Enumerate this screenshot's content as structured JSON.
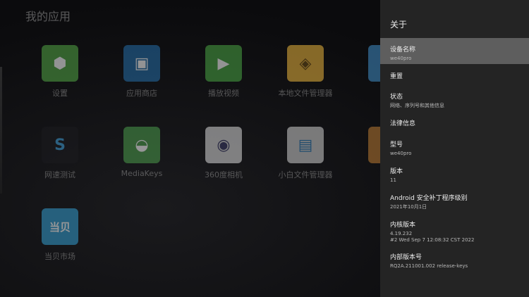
{
  "launcher": {
    "title": "我的应用",
    "apps": [
      {
        "label": "设置",
        "color": "#4caa3e",
        "icon": "gear-icon",
        "glyph": "⬢"
      },
      {
        "label": "应用商店",
        "color": "#1e6fb0",
        "icon": "bag-icon",
        "glyph": "▣"
      },
      {
        "label": "播放视频",
        "color": "#43a83c",
        "icon": "play-icon",
        "glyph": "▶"
      },
      {
        "label": "本地文件管理器",
        "color": "#f0b530",
        "icon": "folder-icon",
        "glyph": "◈"
      },
      {
        "label": "",
        "color": "#3a8fd0",
        "icon": "app-icon",
        "glyph": ""
      },
      {
        "label": "网速测试",
        "color": "#1e1e22",
        "icon": "speed-icon",
        "glyph": "S"
      },
      {
        "label": "MediaKeys",
        "color": "#46a046",
        "icon": "android-icon",
        "glyph": "◒"
      },
      {
        "label": "360度相机",
        "color": "#d8d8d8",
        "icon": "camera-icon",
        "glyph": "◉"
      },
      {
        "label": "小白文件管理器",
        "color": "#cfcfcf",
        "icon": "files-icon",
        "glyph": "▤"
      },
      {
        "label": "",
        "color": "#c07a2a",
        "icon": "app-icon",
        "glyph": ""
      },
      {
        "label": "当贝市场",
        "color": "#2aa0d8",
        "icon": "dangbei-icon",
        "glyph": "当贝"
      }
    ]
  },
  "panel": {
    "title": "关于",
    "items": [
      {
        "title": "设备名称",
        "sub": "we40pro"
      },
      {
        "title": "重置",
        "sub": ""
      },
      {
        "title": "状态",
        "sub": "网络、序列号和其他信息"
      },
      {
        "title": "法律信息",
        "sub": ""
      },
      {
        "title": "型号",
        "sub": "we40pro"
      },
      {
        "title": "版本",
        "sub": "11"
      },
      {
        "title": "Android 安全补丁程序级别",
        "sub": "2021年10月1日"
      },
      {
        "title": "内核版本",
        "sub": "4.19.232",
        "sub2": "#2 Wed Sep 7 12:08:32 CST 2022"
      },
      {
        "title": "内部版本号",
        "sub": "RQ2A.211001.002 release-keys"
      }
    ]
  }
}
